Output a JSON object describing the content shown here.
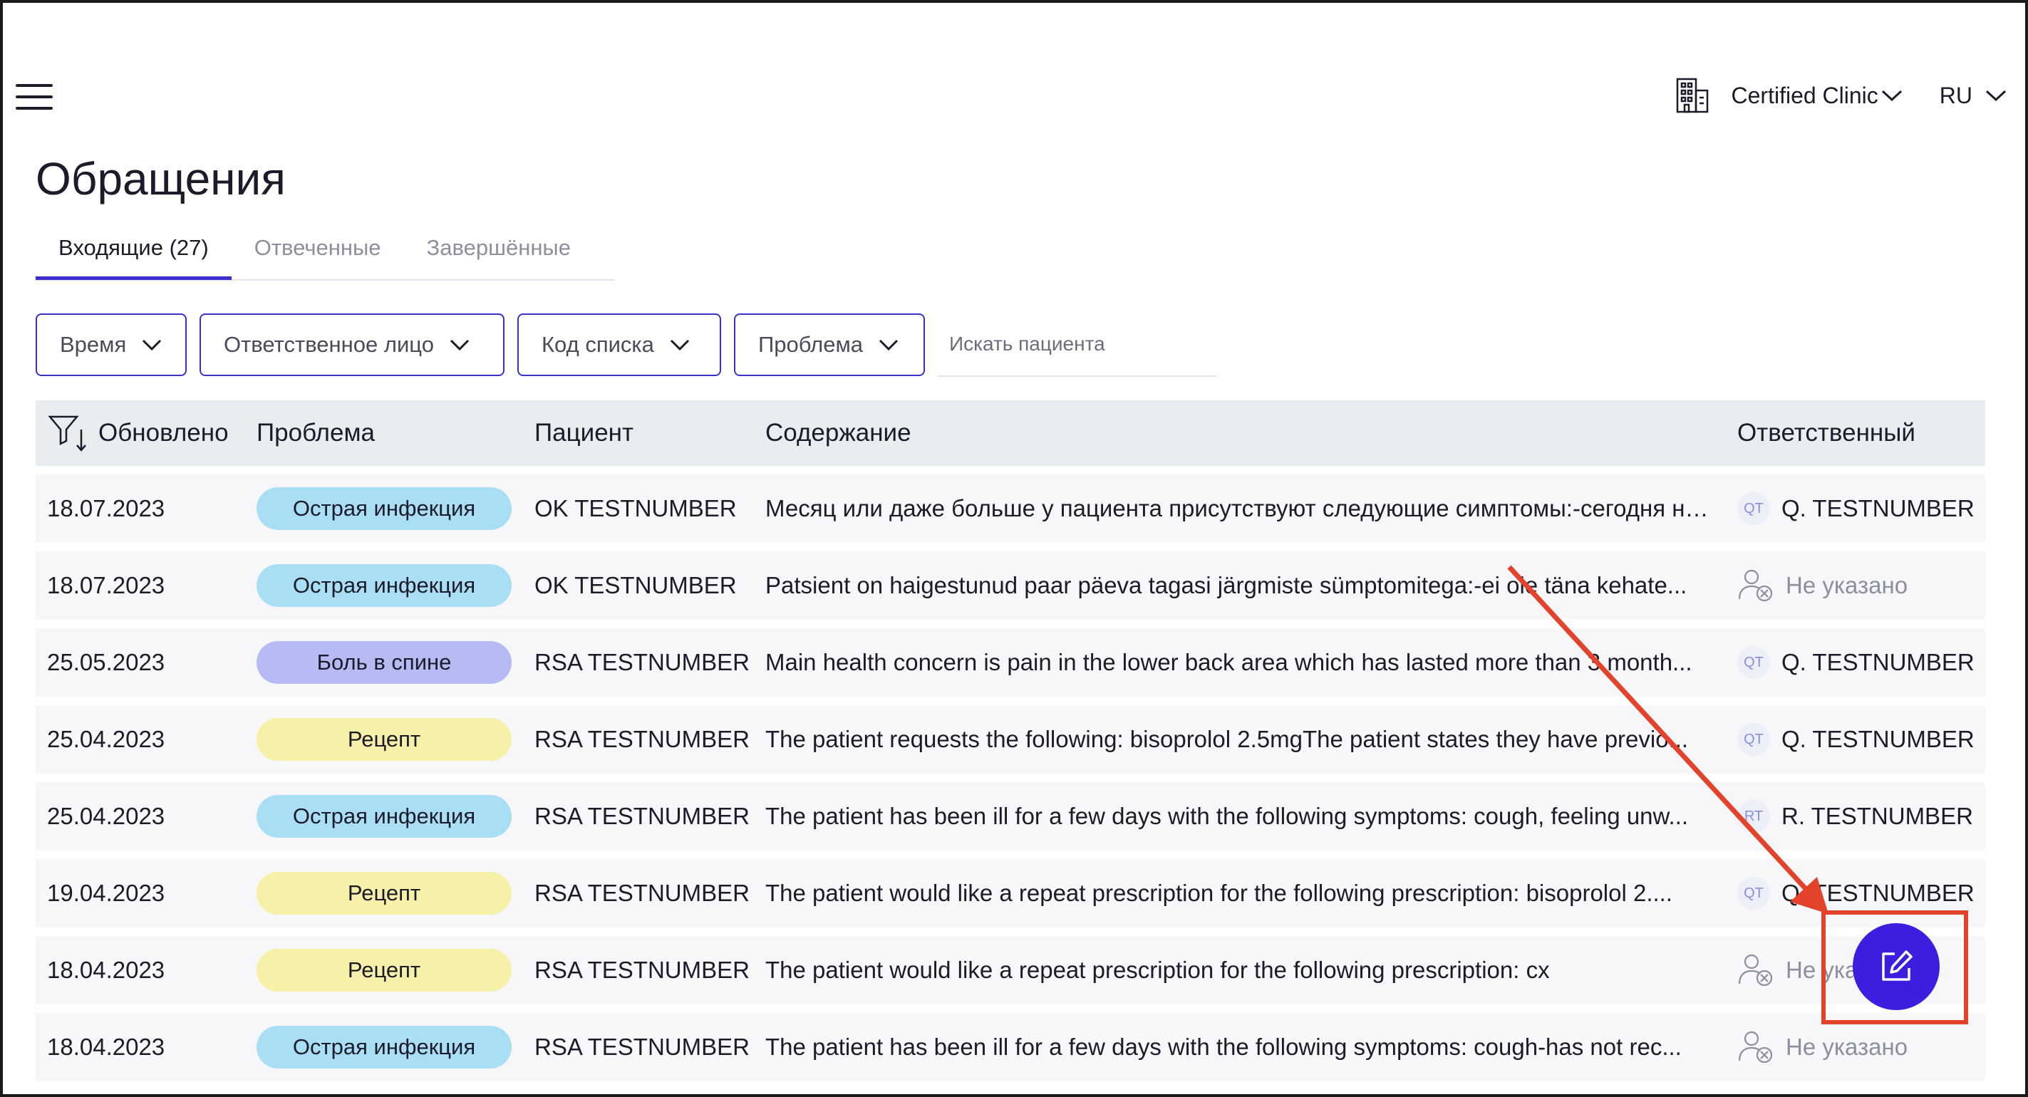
{
  "header": {
    "clinic_name": "Certified Clinic",
    "language": "RU",
    "icons": [
      "menu-icon",
      "building-icon",
      "chevron-down-icon"
    ]
  },
  "page": {
    "title": "Обращения"
  },
  "tabs": [
    {
      "label": "Входящие (27)",
      "active": true
    },
    {
      "label": "Отвеченные",
      "active": false
    },
    {
      "label": "Завершённые",
      "active": false
    }
  ],
  "filters": [
    {
      "label": "Время"
    },
    {
      "label": "Ответственное лицо"
    },
    {
      "label": "Код списка"
    },
    {
      "label": "Проблема"
    }
  ],
  "search": {
    "placeholder": "Искать пациента",
    "value": ""
  },
  "table": {
    "columns": [
      "Обновлено",
      "Проблема",
      "Пациент",
      "Содержание",
      "Ответственный"
    ],
    "rows": [
      {
        "date": "18.07.2023",
        "problem": "Острая инфекция",
        "problem_color": "#a9def5",
        "patient": "OK TESTNUMBER",
        "content": "Месяц или даже больше у пациента присутствуют следующие симптомы:-сегодня не ...",
        "assignee": "Q. TESTNUMBER",
        "initials": "QT",
        "assigned": true
      },
      {
        "date": "18.07.2023",
        "problem": "Острая инфекция",
        "problem_color": "#a9def5",
        "patient": "OK TESTNUMBER",
        "content": "Patsient on haigestunud paar päeva tagasi järgmiste sümptomitega:-ei ole täna kehate...",
        "assignee": "Не указано",
        "initials": "",
        "assigned": false
      },
      {
        "date": "25.05.2023",
        "problem": "Боль в спине",
        "problem_color": "#b7bbf4",
        "patient": "RSA TESTNUMBER",
        "content": "Main health concern is pain in the lower back area which has lasted more than 3 month...",
        "assignee": "Q. TESTNUMBER",
        "initials": "QT",
        "assigned": true
      },
      {
        "date": "25.04.2023",
        "problem": "Рецепт",
        "problem_color": "#f6f0a8",
        "patient": "RSA TESTNUMBER",
        "content": "The patient requests the following: bisoprolol 2.5mgThe patient states they have previo...",
        "assignee": "Q. TESTNUMBER",
        "initials": "QT",
        "assigned": true
      },
      {
        "date": "25.04.2023",
        "problem": "Острая инфекция",
        "problem_color": "#a9def5",
        "patient": "RSA TESTNUMBER",
        "content": "The patient has been ill for a few days with the following symptoms: cough, feeling unw...",
        "assignee": "R. TESTNUMBER",
        "initials": "RT",
        "assigned": true
      },
      {
        "date": "19.04.2023",
        "problem": "Рецепт",
        "problem_color": "#f6f0a8",
        "patient": "RSA TESTNUMBER",
        "content": "The patient would like a repeat prescription for the following prescription: bisoprolol 2....",
        "assignee": "Q. TESTNUMBER",
        "initials": "QT",
        "assigned": true
      },
      {
        "date": "18.04.2023",
        "problem": "Рецепт",
        "problem_color": "#f6f0a8",
        "patient": "RSA TESTNUMBER",
        "content": "The patient would like a repeat prescription for the following prescription: cx",
        "assignee": "Не указано",
        "initials": "",
        "assigned": false
      },
      {
        "date": "18.04.2023",
        "problem": "Острая инфекция",
        "problem_color": "#a9def5",
        "patient": "RSA TESTNUMBER",
        "content": "The patient has been ill for a few days with the following symptoms: cough-has not rec...",
        "assignee": "Не указано",
        "initials": "",
        "assigned": false
      }
    ]
  },
  "fab": {
    "icon": "edit-icon"
  },
  "annotation": {
    "color": "#e3422b"
  }
}
